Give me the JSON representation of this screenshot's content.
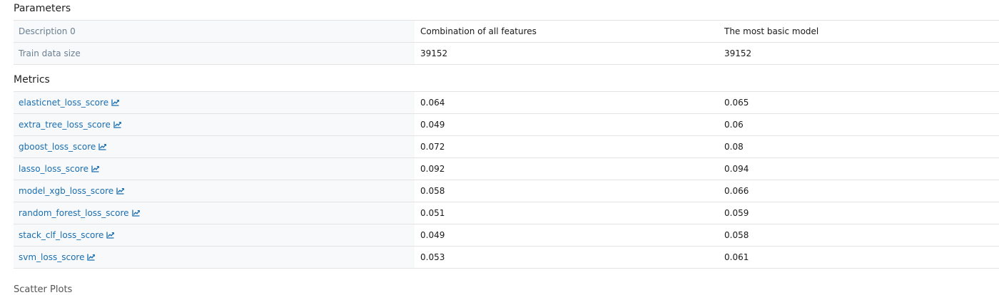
{
  "parameters": {
    "title": "Parameters",
    "rows": [
      {
        "label": "Description 0",
        "v1": "Combination of all features",
        "v2": "The most basic model"
      },
      {
        "label": "Train data size",
        "v1": "39152",
        "v2": "39152"
      }
    ]
  },
  "metrics": {
    "title": "Metrics",
    "icon": "chart-icon",
    "rows": [
      {
        "label": "elasticnet_loss_score",
        "v1": "0.064",
        "v2": "0.065"
      },
      {
        "label": "extra_tree_loss_score",
        "v1": "0.049",
        "v2": "0.06"
      },
      {
        "label": "gboost_loss_score",
        "v1": "0.072",
        "v2": "0.08"
      },
      {
        "label": "lasso_loss_score",
        "v1": "0.092",
        "v2": "0.094"
      },
      {
        "label": "model_xgb_loss_score",
        "v1": "0.058",
        "v2": "0.066"
      },
      {
        "label": "random_forest_loss_score",
        "v1": "0.051",
        "v2": "0.059"
      },
      {
        "label": "stack_clf_loss_score",
        "v1": "0.049",
        "v2": "0.058"
      },
      {
        "label": "svm_loss_score",
        "v1": "0.053",
        "v2": "0.061"
      }
    ]
  },
  "footer": {
    "title": "Scatter Plots"
  }
}
